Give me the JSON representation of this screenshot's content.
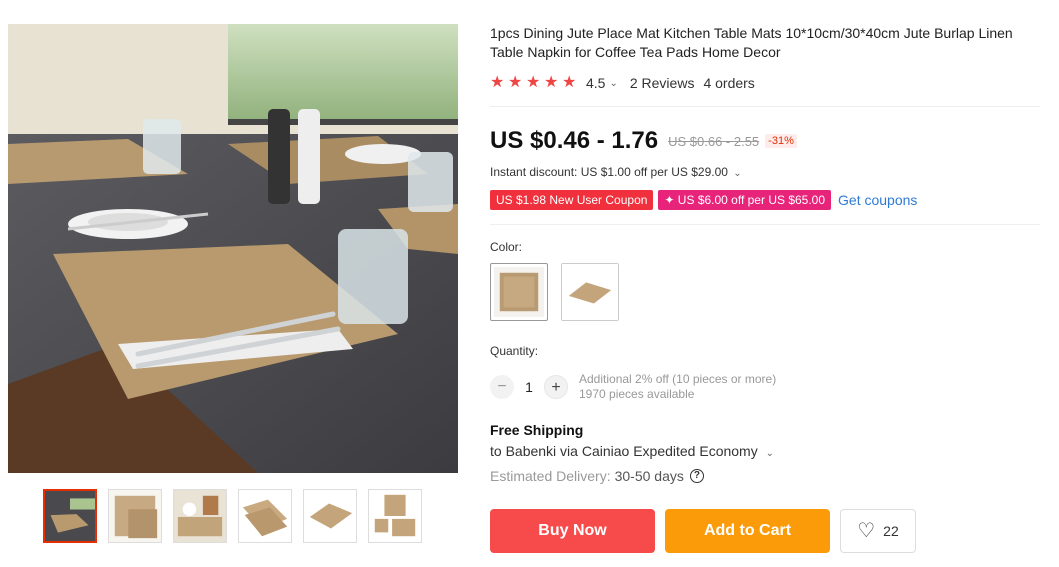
{
  "product": {
    "title": "1pcs Dining Jute Place Mat Kitchen Table Mats 10*10cm/30*40cm Jute Burlap Linen Table Napkin for Coffee Tea Pads Home Decor",
    "rating": "4.5",
    "reviews": "2 Reviews",
    "orders": "4 orders",
    "price": "US $0.46 - 1.76",
    "old_price": "US $0.66 - 2.55",
    "discount": "-31%",
    "instant_discount": "Instant discount: US $1.00 off per US $29.00",
    "coupons": [
      "US $1.98 New User Coupon",
      "✦ US $6.00 off per US $65.00"
    ],
    "get_coupons": "Get coupons"
  },
  "options": {
    "color_label": "Color:",
    "quantity_label": "Quantity:",
    "quantity_value": "1",
    "qty_minus": "−",
    "qty_plus": "+",
    "qty_note": "Additional 2% off (10 pieces or more)",
    "qty_available": "1970 pieces available"
  },
  "shipping": {
    "title": "Free Shipping",
    "to": "to Babenki via Cainiao Expedited Economy",
    "delivery_label": "Estimated Delivery:",
    "delivery_days": "30-50 days"
  },
  "actions": {
    "buy_now": "Buy Now",
    "add_to_cart": "Add to Cart",
    "wishlist_count": "22"
  },
  "icons": {
    "star": "★",
    "chevron": "⌄",
    "heart": "♡",
    "help": "?"
  },
  "colors": {
    "accent": "#f74a4a",
    "cart": "#fb9b0a",
    "star": "#f04545",
    "coupon_red": "#f0303c",
    "coupon_pink": "#e8237a",
    "link": "#2e7bd6"
  }
}
